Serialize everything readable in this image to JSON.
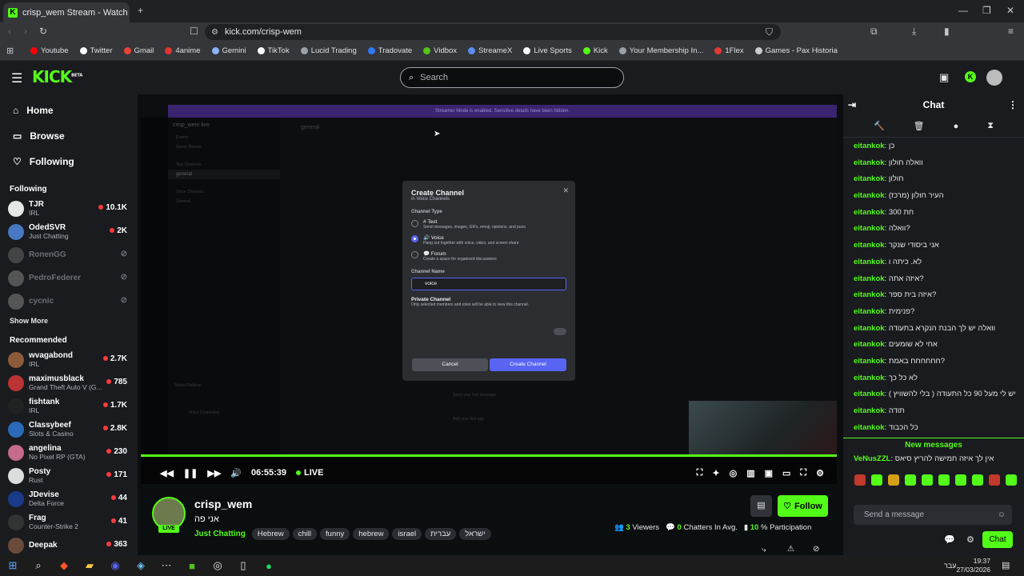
{
  "browser": {
    "tab_title": "crisp_wem Stream - Watch Li...",
    "url": "kick.com/crisp-wem",
    "bookmarks": [
      {
        "label": "Youtube",
        "color": "#ff0000"
      },
      {
        "label": "Twitter",
        "color": "#ffffff"
      },
      {
        "label": "Gmail",
        "color": "#ea4335"
      },
      {
        "label": "4anime",
        "color": "#e3342f"
      },
      {
        "label": "Gemini",
        "color": "#8ab4f8"
      },
      {
        "label": "TikTok",
        "color": "#ffffff"
      },
      {
        "label": "Lucid Trading",
        "color": "#9aa0a6"
      },
      {
        "label": "Tradovate",
        "color": "#2f7bf5"
      },
      {
        "label": "Vidbox",
        "color": "#53c41a"
      },
      {
        "label": "StreameX",
        "color": "#5b8def"
      },
      {
        "label": "Live Sports",
        "color": "#ffffff"
      },
      {
        "label": "Kick",
        "color": "#53fc18"
      },
      {
        "label": "Your Membership In...",
        "color": "#9aa0a6"
      },
      {
        "label": "1Flex",
        "color": "#e53935"
      },
      {
        "label": "Games - Pax Historia",
        "color": "#cccccc"
      }
    ]
  },
  "kick": {
    "logo": "KICK",
    "beta": "BETA",
    "search_placeholder": "Search",
    "nav": [
      {
        "label": "Home",
        "icon": "home-icon"
      },
      {
        "label": "Browse",
        "icon": "browse-icon"
      },
      {
        "label": "Following",
        "icon": "heart-icon"
      }
    ],
    "following_title": "Following",
    "following": [
      {
        "name": "TJR",
        "cat": "IRL",
        "viewers": "10.1K",
        "color": "#e6e6e6",
        "online": true
      },
      {
        "name": "OdedSVR",
        "cat": "Just Chatting",
        "viewers": "2K",
        "color": "#4a78c2",
        "online": true
      },
      {
        "name": "RonenGG",
        "cat": "",
        "viewers": "",
        "color": "#444",
        "online": false
      },
      {
        "name": "PedroFederer",
        "cat": "",
        "viewers": "",
        "color": "#555",
        "online": false
      },
      {
        "name": "cycnic",
        "cat": "",
        "viewers": "",
        "color": "#555",
        "online": false
      }
    ],
    "show_more": "Show More",
    "recommended_title": "Recommended",
    "recommended": [
      {
        "name": "wvagabond",
        "cat": "IRL",
        "viewers": "2.7K",
        "color": "#8a5a3a"
      },
      {
        "name": "maximusblack",
        "cat": "Grand Theft Auto V (G...",
        "viewers": "785",
        "color": "#b33"
      },
      {
        "name": "fishtank",
        "cat": "IRL",
        "viewers": "1.7K",
        "color": "#222"
      },
      {
        "name": "Classybeef",
        "cat": "Slots & Casino",
        "viewers": "2.8K",
        "color": "#2a6ab8"
      },
      {
        "name": "angelina",
        "cat": "No Pixel RP (GTA)",
        "viewers": "230",
        "color": "#c46a8a"
      },
      {
        "name": "Posty",
        "cat": "Rust",
        "viewers": "171",
        "color": "#ddd"
      },
      {
        "name": "JDevise",
        "cat": "Delta Force",
        "viewers": "44",
        "color": "#1a3a8a"
      },
      {
        "name": "Frag",
        "cat": "Counter-Strike 2",
        "viewers": "41",
        "color": "#333"
      },
      {
        "name": "Deepak",
        "cat": "",
        "viewers": "363",
        "color": "#6a4a3a"
      }
    ]
  },
  "discord": {
    "banner": "Streamer Mode is enabled. Sensitive details have been hidden.",
    "server": "crisp_wem live",
    "channel": "general",
    "sidebar_rows": [
      "Events",
      "Server Boosts",
      "Text Channels",
      "general",
      "Voice Channels",
      "General"
    ],
    "bottom_rows": [
      "Select Platform",
      "Send your first message",
      "Add your first app",
      "Voice Connected"
    ],
    "modal": {
      "title": "Create Channel",
      "subtitle": "in Voice Channels",
      "type_label": "Channel Type",
      "options": [
        {
          "name": "Text",
          "desc": "Send messages, images, GIFs, emoji, opinions, and puns",
          "icon": "#",
          "selected": false
        },
        {
          "name": "Voice",
          "desc": "Hang out together with voice, video, and screen share",
          "icon": "🔊",
          "selected": true
        },
        {
          "name": "Forum",
          "desc": "Create a space for organized discussions",
          "icon": "💬",
          "selected": false
        }
      ],
      "name_label": "Channel Name",
      "name_value": "voice",
      "private_label": "Private Channel",
      "private_desc": "Only selected members and roles will be able to view this channel.",
      "cancel": "Cancel",
      "create": "Create Channel"
    }
  },
  "player": {
    "time": "06:55:39",
    "live": "LIVE",
    "progress": 1.0
  },
  "stream": {
    "streamer": "crisp_wem",
    "live_badge": "LIVE",
    "title": "אני פה",
    "category": "Just Chatting",
    "tags": [
      "Hebrew",
      "chill",
      "funny",
      "hebrew",
      "israel",
      "עברית",
      "ישראל"
    ],
    "follow": "Follow",
    "viewers_num": "3",
    "viewers_label": "Viewers",
    "chatters_num": "0",
    "chatters_label": "Chatters In Avg.",
    "participation_num": "10",
    "participation_label": "% Participation"
  },
  "chat": {
    "title": "Chat",
    "messages": [
      {
        "user": "eitankok",
        "text": "כן"
      },
      {
        "user": "eitankok",
        "text": "וואלה חולון"
      },
      {
        "user": "eitankok",
        "text": "חולון"
      },
      {
        "user": "eitankok",
        "text": "העיר חולון (מרכז)"
      },
      {
        "user": "eitankok",
        "text": "חת 300"
      },
      {
        "user": "eitankok",
        "text": "וואלה?"
      },
      {
        "user": "eitankok",
        "text": "אני ביסודי שנקר"
      },
      {
        "user": "eitankok",
        "text": "לא. כיתה ו"
      },
      {
        "user": "eitankok",
        "text": "איזה אתה?"
      },
      {
        "user": "eitankok",
        "text": "איזה בית ספר?"
      },
      {
        "user": "eitankok",
        "text": "פנימית?"
      },
      {
        "user": "eitankok",
        "text": "וואלה יש לך הבנת הנקרא בתעודה"
      },
      {
        "user": "eitankok",
        "text": "אחי לא שומעים"
      },
      {
        "user": "eitankok",
        "text": "חחחחחח באמת?"
      },
      {
        "user": "eitankok",
        "text": "לא כל כך"
      },
      {
        "user": "eitankok",
        "text": "יש לי מעל 90 כל התעודה ( בלי להשוויץ )"
      },
      {
        "user": "eitankok",
        "text": "תודה"
      },
      {
        "user": "eitankok",
        "text": "כל הכבוד"
      }
    ],
    "new_messages": "New messages",
    "last_message": {
      "user": "VeNusZZL",
      "text": "אין לך איזה חמישה להריץ סיאס"
    },
    "send_placeholder": "Send a message",
    "chat_button": "Chat"
  },
  "taskbar": {
    "time": "19:37",
    "date": "27/03/2026",
    "lang": "עבר"
  }
}
